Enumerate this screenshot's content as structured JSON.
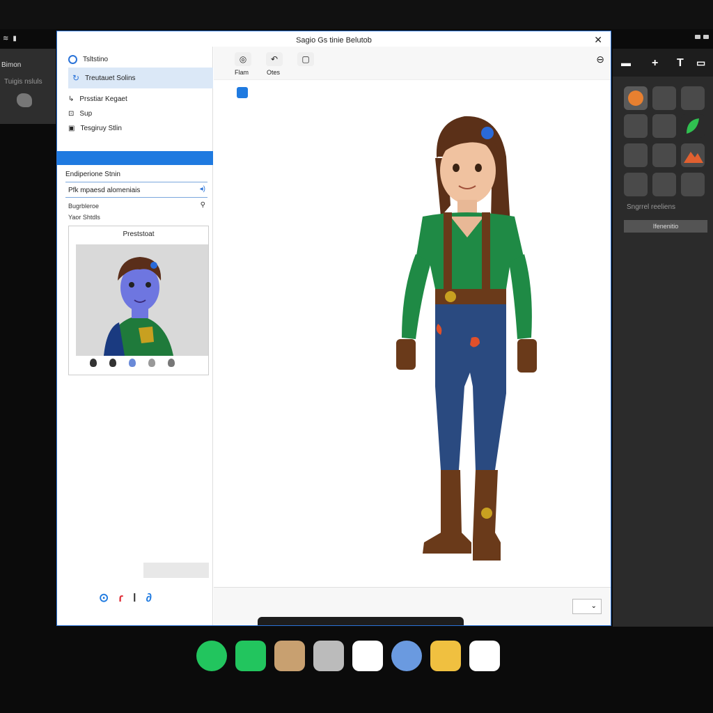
{
  "status": {
    "left_label": "Bimon",
    "left_sub": "Tuigis nsluls"
  },
  "window": {
    "title": "Sagio Gs tinie Belutob",
    "close": "✕"
  },
  "sidebar": {
    "items": [
      {
        "label": "Tsltstino"
      },
      {
        "label": "Treutauet Solins"
      },
      {
        "label": "Prsstiar Kegaet"
      },
      {
        "label": "Sup"
      },
      {
        "label": "Tesgiruy Stlin"
      }
    ],
    "section_title": "Endiperione Stnin",
    "field_label": "Pfk mpaesd alomeniais",
    "option1": "Bugrbleroe",
    "option2": "Yaor Shtdls",
    "preview_title": "Preststoat"
  },
  "toolbar": {
    "btn1_label": "Flam",
    "btn2_label": "Otes"
  },
  "right_panel": {
    "label": "Sngrrel reeliens",
    "button": "Ifenenitio"
  },
  "dock": {
    "apps": [
      "phone-app",
      "messages-app",
      "photos-app",
      "files-app",
      "calendar-app",
      "maps-app",
      "notes-app",
      "music-app"
    ]
  },
  "colors": {
    "accent": "#1f7ae0",
    "dark_bg": "#0b0b0b"
  }
}
